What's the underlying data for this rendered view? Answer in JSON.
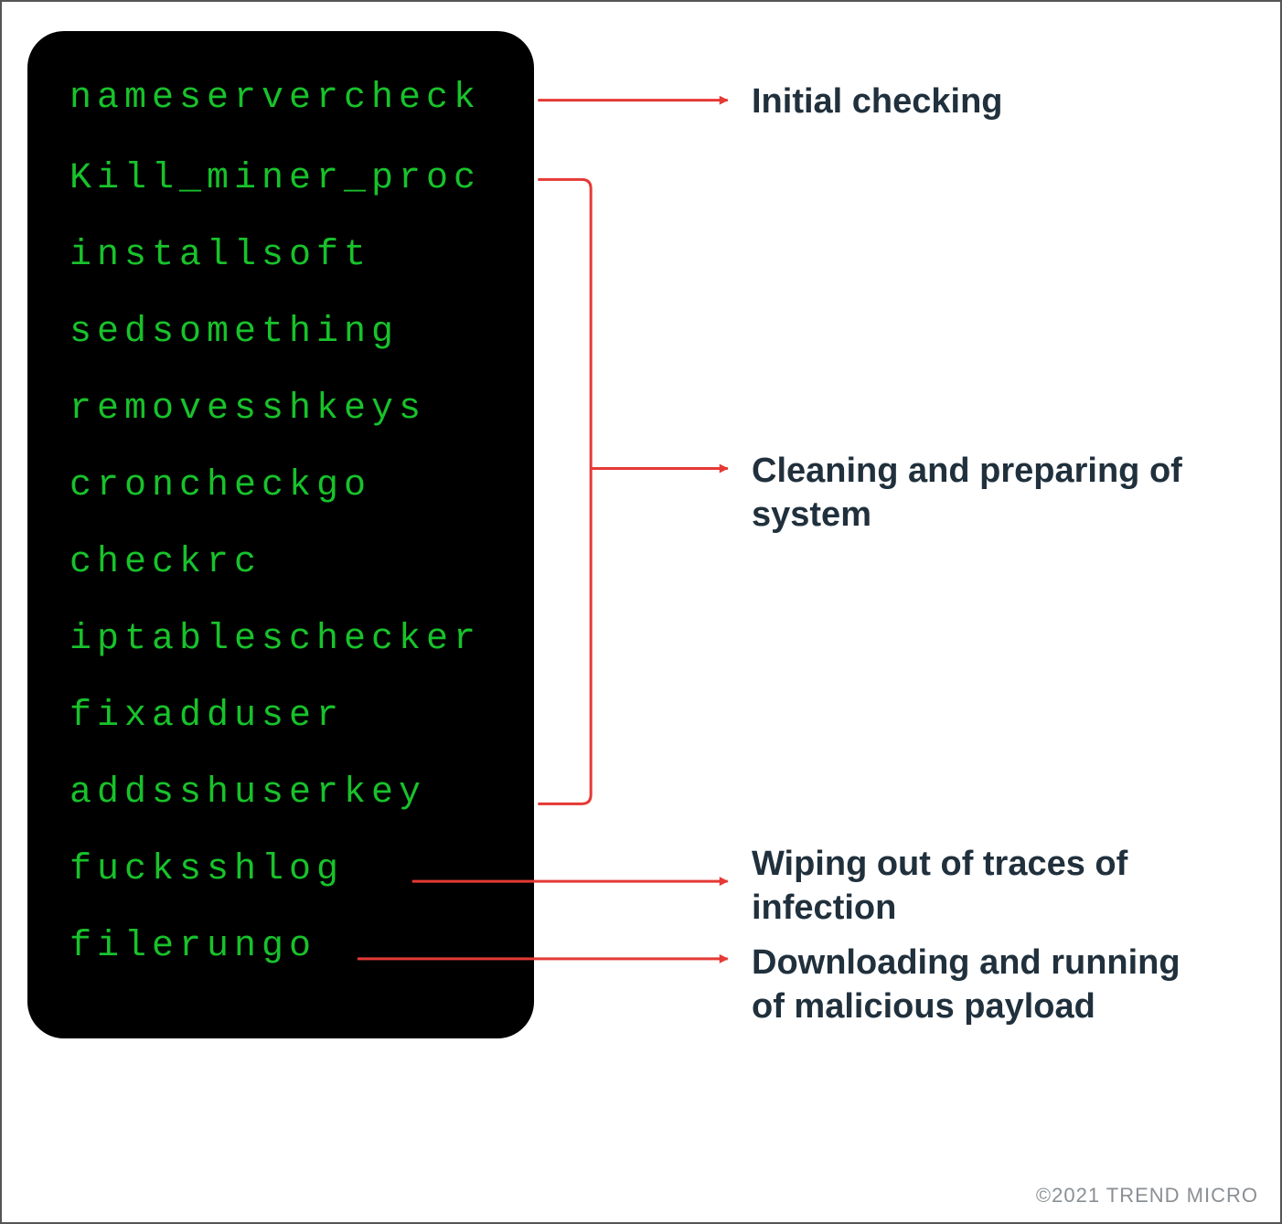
{
  "terminal": {
    "lines": [
      "nameservercheck",
      "Kill_miner_proc",
      "installsoft",
      "sedsomething",
      "removesshkeys",
      "croncheckgo",
      "checkrc",
      "iptableschecker",
      "fixadduser",
      "addsshuserkey",
      "fucksshlog",
      "filerungo"
    ]
  },
  "labels": {
    "initial": "Initial checking",
    "cleaning": "Cleaning and preparing of system",
    "wiping": "Wiping out of traces of infection",
    "downloading": "Downloading and running of malicious payload"
  },
  "copyright": "©2021 TREND MICRO",
  "colors": {
    "terminal_bg": "#000000",
    "terminal_text": "#18c22b",
    "label_text": "#20303c",
    "arrow": "#e53935"
  },
  "chart_data": {
    "type": "table",
    "title": "Malware script function annotations",
    "mappings": [
      {
        "functions": [
          "nameservercheck"
        ],
        "purpose": "Initial checking"
      },
      {
        "functions": [
          "Kill_miner_proc",
          "installsoft",
          "sedsomething",
          "removesshkeys",
          "croncheckgo",
          "checkrc",
          "iptableschecker",
          "fixadduser",
          "addsshuserkey"
        ],
        "purpose": "Cleaning and preparing of system"
      },
      {
        "functions": [
          "fucksshlog"
        ],
        "purpose": "Wiping out of traces of infection"
      },
      {
        "functions": [
          "filerungo"
        ],
        "purpose": "Downloading and running of malicious payload"
      }
    ]
  }
}
